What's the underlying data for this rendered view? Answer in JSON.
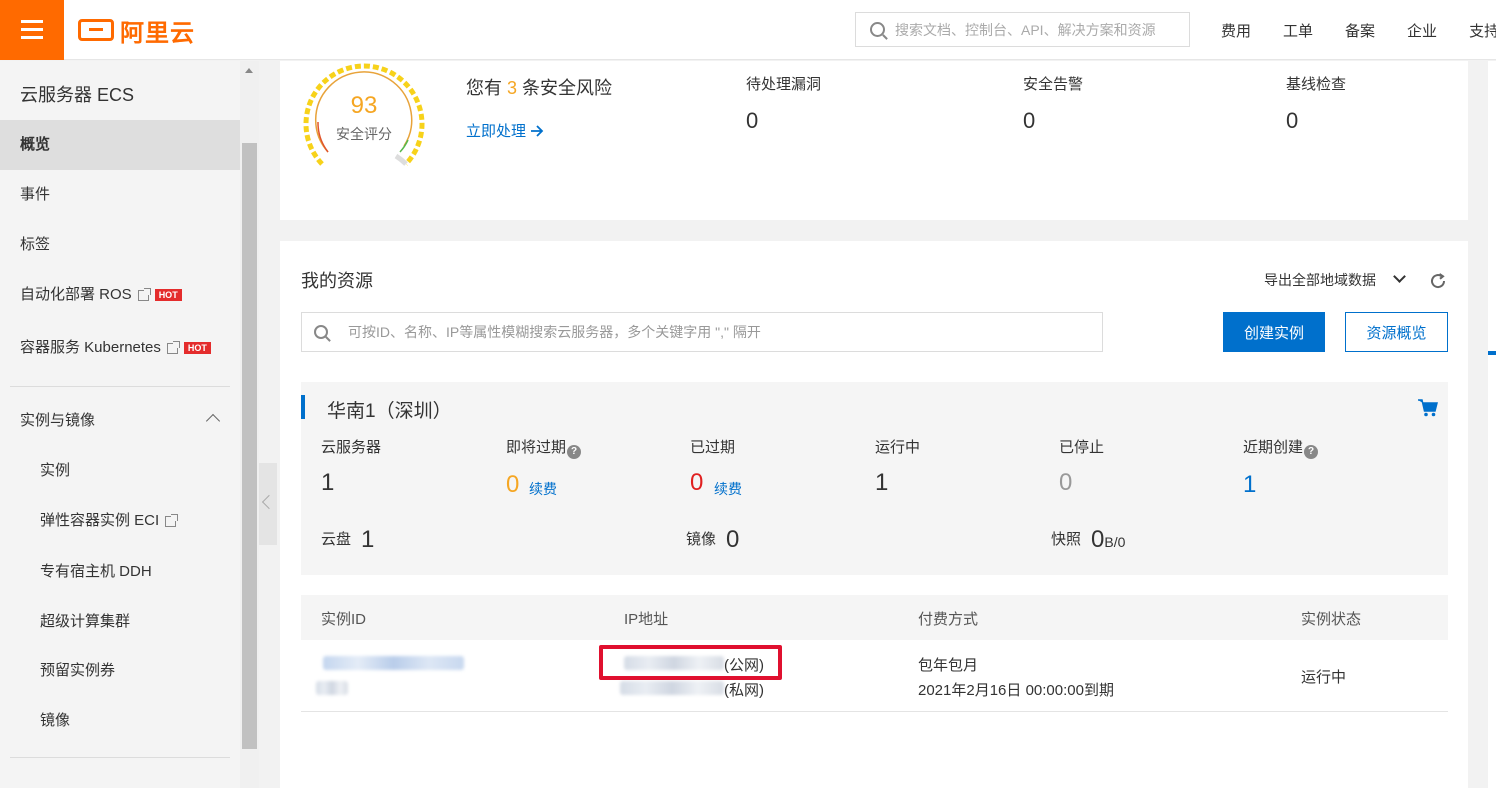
{
  "topbar": {
    "logo_text": "阿里云",
    "search_placeholder": "搜索文档、控制台、API、解决方案和资源",
    "nav": [
      "费用",
      "工单",
      "备案",
      "企业",
      "支持"
    ]
  },
  "sidebar": {
    "title": "云服务器 ECS",
    "items": [
      {
        "label": "概览",
        "active": true
      },
      {
        "label": "事件"
      },
      {
        "label": "标签"
      },
      {
        "label": "自动化部署 ROS",
        "external": true,
        "badge": "HOT"
      },
      {
        "label": "容器服务 Kubernetes",
        "external": true,
        "badge": "HOT"
      }
    ],
    "section": {
      "label": "实例与镜像",
      "expanded": true,
      "items": [
        {
          "label": "实例"
        },
        {
          "label": "弹性容器实例 ECI",
          "external": true
        },
        {
          "label": "专有宿主机 DDH"
        },
        {
          "label": "超级计算集群"
        },
        {
          "label": "预留实例券"
        },
        {
          "label": "镜像"
        }
      ]
    }
  },
  "security": {
    "score": "93",
    "score_label": "安全评分",
    "risk_prefix": "您有",
    "risk_count": "3",
    "risk_suffix": "条安全风险",
    "action_link": "立即处理",
    "stats": [
      {
        "label": "待处理漏洞",
        "value": "0"
      },
      {
        "label": "安全告警",
        "value": "0"
      },
      {
        "label": "基线检查",
        "value": "0"
      }
    ]
  },
  "resources": {
    "title": "我的资源",
    "export_label": "导出全部地域数据",
    "search_placeholder": "可按ID、名称、IP等属性模糊搜索云服务器，多个关键字用 \",\" 隔开",
    "create_button": "创建实例",
    "overview_button": "资源概览",
    "region": {
      "name": "华南1（深圳）",
      "stats": [
        {
          "label": "云服务器",
          "value": "1",
          "color": "#333333"
        },
        {
          "label": "即将过期",
          "value": "0",
          "color": "#f5a623",
          "help": true,
          "renew": "续费"
        },
        {
          "label": "已过期",
          "value": "0",
          "color": "#e02020",
          "renew": "续费"
        },
        {
          "label": "运行中",
          "value": "1",
          "color": "#333333"
        },
        {
          "label": "已停止",
          "value": "0",
          "color": "#999999"
        },
        {
          "label": "近期创建",
          "value": "1",
          "color": "#0070cc",
          "help": true
        }
      ],
      "storage": [
        {
          "label": "云盘",
          "value": "1"
        },
        {
          "label": "镜像",
          "value": "0"
        },
        {
          "label": "快照",
          "value": "0",
          "unit": "B/0"
        }
      ]
    },
    "table": {
      "columns": [
        "实例ID",
        "IP地址",
        "付费方式",
        "实例状态"
      ],
      "rows": [
        {
          "public_ip_suffix": "(公网)",
          "private_ip_suffix": "(私网)",
          "billing": "包年包月",
          "expiry": "2021年2月16日 00:00:00到期",
          "status": "运行中"
        }
      ]
    }
  },
  "colors": {
    "brand": "#ff6a00",
    "link": "#0070cc",
    "highlight_box": "#e0102f",
    "warning": "#f5a623",
    "danger": "#e02020"
  }
}
